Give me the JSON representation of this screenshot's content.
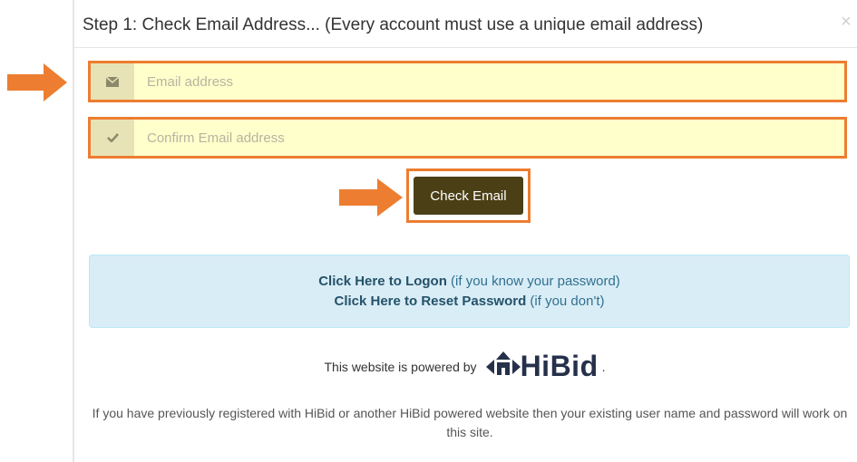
{
  "modal": {
    "title": "Step 1: Check Email Address... (Every account must use a unique email address)",
    "close_symbol": "×"
  },
  "form": {
    "email_placeholder": "Email address",
    "confirm_placeholder": "Confirm Email address",
    "email_icon": "envelope-icon",
    "confirm_icon": "check-icon",
    "submit_label": "Check Email"
  },
  "info": {
    "logon_link": "Click Here to Logon",
    "logon_note": " (if you know your password)",
    "reset_link": "Click Here to Reset Password",
    "reset_note": " (if you don't)"
  },
  "powered": {
    "text": "This website is powered by",
    "brand": "HiBid",
    "trailing": "."
  },
  "footnote": "If you have previously registered with HiBid or another HiBid powered website then your existing user name and password will work on this site.",
  "colors": {
    "highlight_orange": "#ed7d31",
    "button_bg": "#4b3f16",
    "input_bg": "#ffffcc",
    "info_bg": "#d9edf7"
  }
}
